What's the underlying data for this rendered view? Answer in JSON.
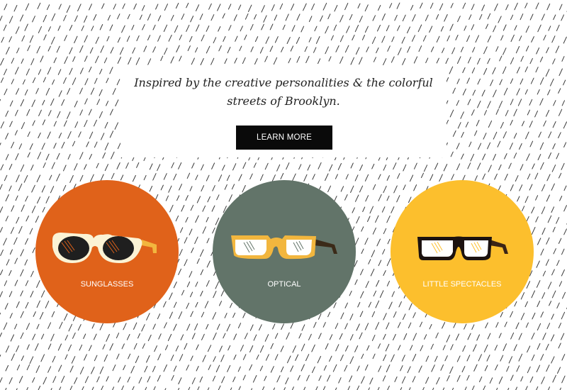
{
  "hero": {
    "tagline_line1": "Inspired by the creative personalities & the colorful",
    "tagline_line2": "streets of Brooklyn.",
    "button_label": "LEARN MORE"
  },
  "categories": [
    {
      "label": "SUNGLASSES",
      "color": "#e0621a",
      "icon": "sunglasses-icon"
    },
    {
      "label": "OPTICAL",
      "color": "#627469",
      "icon": "optical-glasses-icon"
    },
    {
      "label": "LITTLE SPECTACLES",
      "color": "#fcbf2d",
      "icon": "kids-glasses-icon"
    }
  ],
  "colors": {
    "background": "#ffffff",
    "pattern_stroke": "#3a3a3a",
    "button_bg": "#0a0a0a",
    "button_text": "#ffffff",
    "tagline_text": "#222222"
  }
}
